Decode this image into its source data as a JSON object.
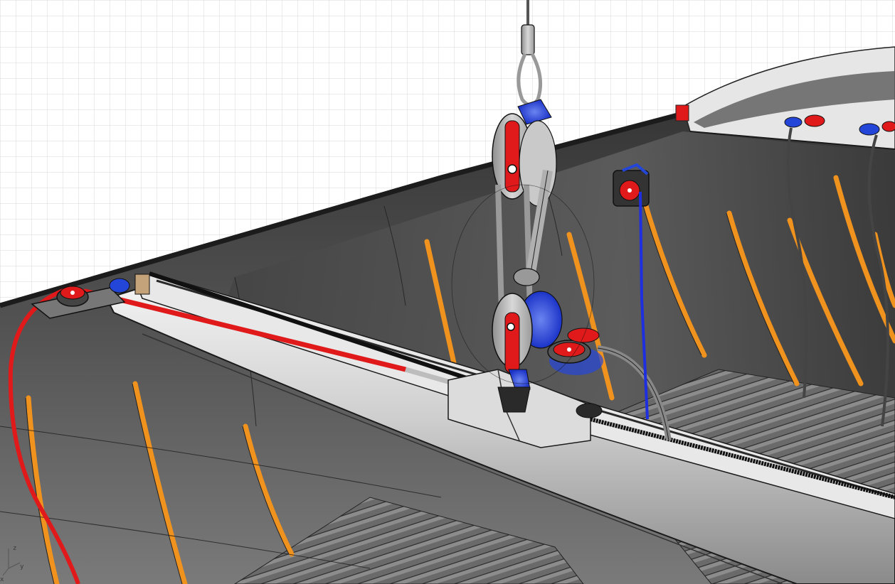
{
  "viewport": {
    "view": "perspective",
    "display_mode": "ghosted-shaded",
    "grid": true,
    "axis_widget": {
      "x_label": "x",
      "y_label": "y",
      "z_label": "z"
    }
  },
  "scene": {
    "objects": [
      "hull",
      "cockpit-floor",
      "ribs",
      "gunwale",
      "boom",
      "traveler-track",
      "mainsheet-block",
      "shackle-pin",
      "cam-cleat-block",
      "cleats",
      "control-lines",
      "upper-rigging-wire"
    ]
  },
  "colors": {
    "grid_line": "#d8d8d8",
    "hull_dark": "#404040",
    "rib_orange": "#f0921e",
    "control_line_red": "#e01a1a",
    "control_line_blue": "#1e2fe0",
    "highlight_blue": "#2446d8",
    "metal_grey": "#b8b8b8"
  }
}
